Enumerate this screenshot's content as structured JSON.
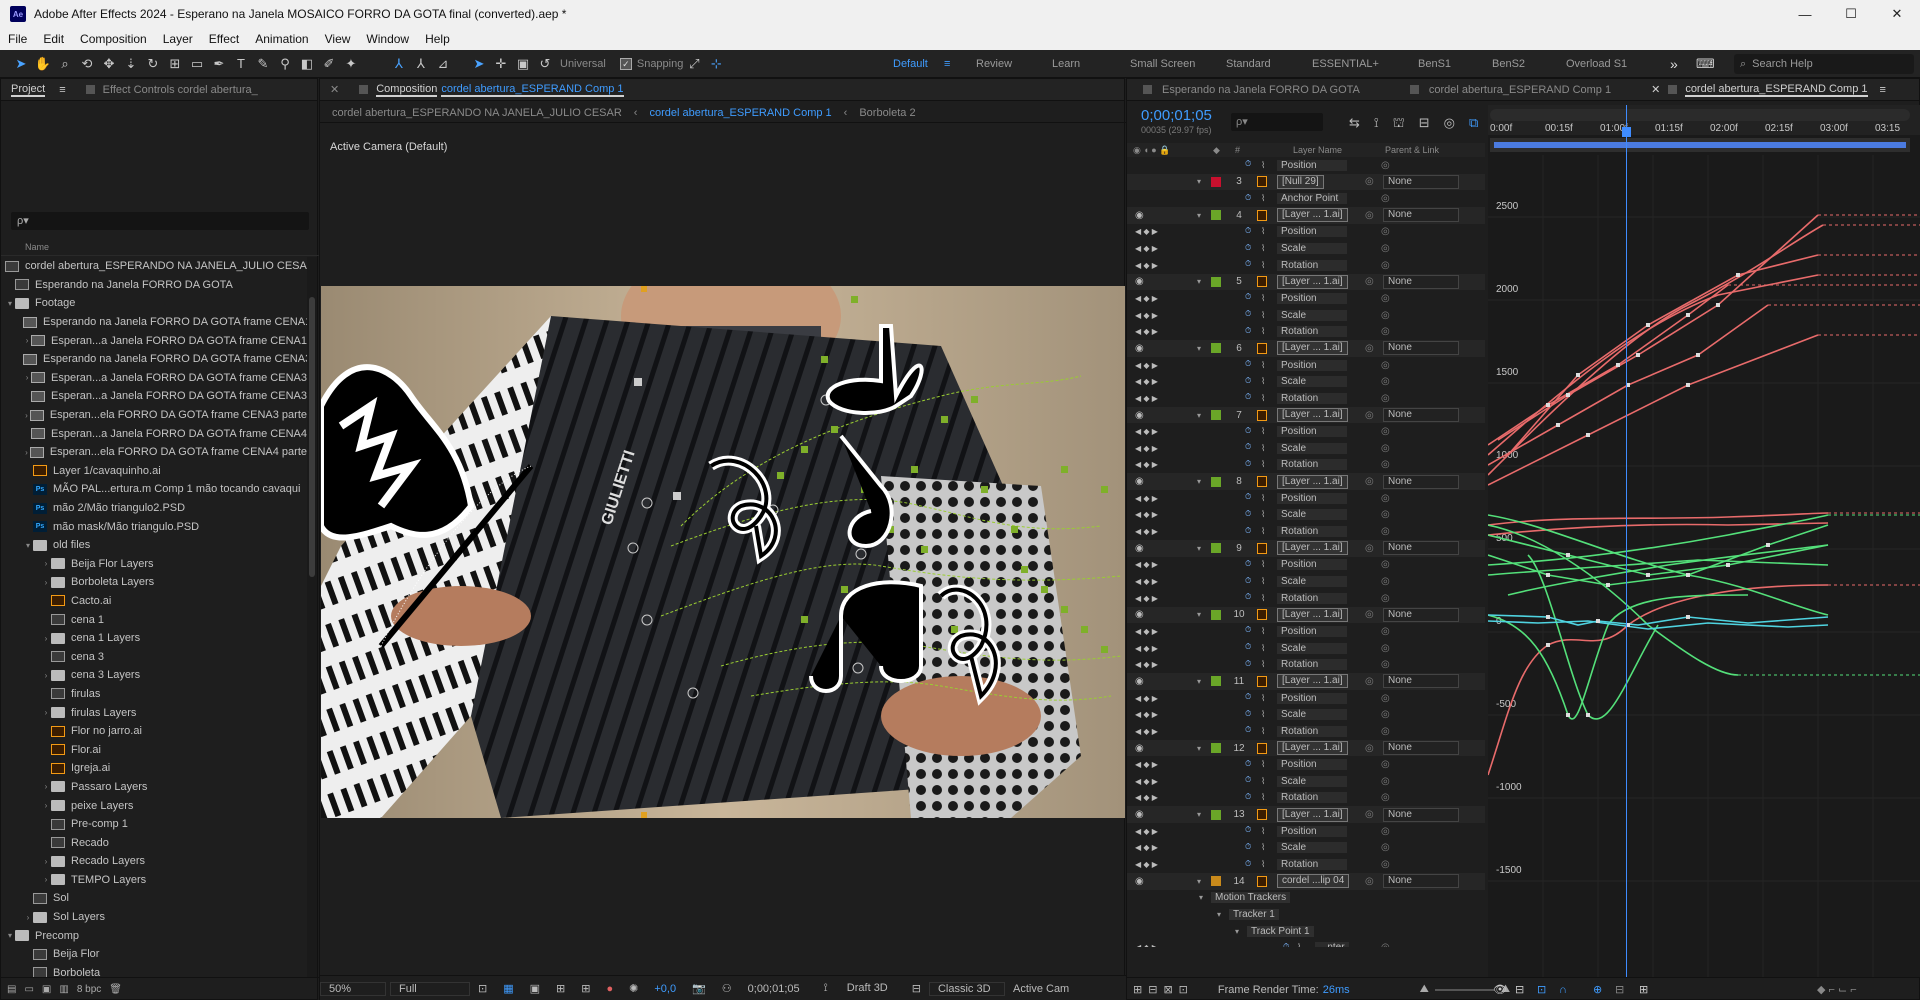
{
  "window": {
    "title": "Adobe After Effects 2024 - Esperano na Janela MOSAICO FORRO DA GOTA final (converted).aep *",
    "logo_text": "Ae",
    "minimize": "—",
    "maximize": "☐",
    "close": "✕"
  },
  "menu": [
    "File",
    "Edit",
    "Composition",
    "Layer",
    "Effect",
    "Animation",
    "View",
    "Window",
    "Help"
  ],
  "toolbar": {
    "universal_label": "Universal",
    "snapping_label": "Snapping",
    "workspaces": [
      "Default",
      "Review",
      "Learn",
      "Small Screen",
      "Standard",
      "ESSENTIAL+",
      "BenS1",
      "BenS2",
      "Overload S1"
    ],
    "active_workspace": "Default",
    "more": "»",
    "search_help": "Search Help"
  },
  "project_panel": {
    "tab_project": "Project",
    "tab_effect_controls": "Effect Controls cordel abertura_",
    "search_placeholder": "ρ▾",
    "column_name": "Name",
    "items": [
      {
        "indent": 0,
        "type": "comp",
        "twirl": "",
        "name": "cordel abertura_ESPERANDO NA JANELA_JULIO CESAR"
      },
      {
        "indent": 0,
        "type": "comp",
        "twirl": "",
        "name": "Esperando na Janela FORRO DA GOTA"
      },
      {
        "indent": 0,
        "type": "folder",
        "twirl": "▾",
        "name": "Footage"
      },
      {
        "indent": 1,
        "type": "film",
        "twirl": "",
        "name": "Esperando na Janela FORRO DA GOTA frame CENA1"
      },
      {
        "indent": 1,
        "type": "film",
        "twirl": "›",
        "name": "Esperan...a Janela FORRO DA GOTA frame CENA1"
      },
      {
        "indent": 1,
        "type": "film",
        "twirl": "",
        "name": "Esperando na Janela FORRO DA GOTA frame CENA3"
      },
      {
        "indent": 1,
        "type": "film",
        "twirl": "›",
        "name": "Esperan...a Janela FORRO DA GOTA frame CENA3"
      },
      {
        "indent": 1,
        "type": "film",
        "twirl": "",
        "name": "Esperan...a Janela FORRO DA GOTA frame CENA3"
      },
      {
        "indent": 1,
        "type": "film",
        "twirl": "›",
        "name": "Esperan...ela FORRO DA GOTA frame CENA3 parte"
      },
      {
        "indent": 1,
        "type": "film",
        "twirl": "",
        "name": "Esperan...a Janela FORRO DA GOTA frame CENA4"
      },
      {
        "indent": 1,
        "type": "film",
        "twirl": "›",
        "name": "Esperan...ela FORRO DA GOTA frame CENA4 parte"
      },
      {
        "indent": 1,
        "type": "ai",
        "twirl": "",
        "name": "Layer 1/cavaquinho.ai"
      },
      {
        "indent": 1,
        "type": "ps",
        "twirl": "",
        "name": "MÃO PAL...ertura.m Comp 1 mão tocando cavaqui"
      },
      {
        "indent": 1,
        "type": "ps",
        "twirl": "",
        "name": "mão 2/Mão triangulo2.PSD"
      },
      {
        "indent": 1,
        "type": "ps",
        "twirl": "",
        "name": "mão mask/Mão triangulo.PSD"
      },
      {
        "indent": 1,
        "type": "folder",
        "twirl": "▾",
        "name": "old files"
      },
      {
        "indent": 2,
        "type": "folder",
        "twirl": "›",
        "name": "Beija Flor Layers"
      },
      {
        "indent": 2,
        "type": "folder",
        "twirl": "›",
        "name": "Borboleta Layers"
      },
      {
        "indent": 2,
        "type": "ai",
        "twirl": "",
        "name": "Cacto.ai"
      },
      {
        "indent": 2,
        "type": "comp",
        "twirl": "",
        "name": "cena 1"
      },
      {
        "indent": 2,
        "type": "folder",
        "twirl": "›",
        "name": "cena 1 Layers"
      },
      {
        "indent": 2,
        "type": "comp",
        "twirl": "",
        "name": "cena 3"
      },
      {
        "indent": 2,
        "type": "folder",
        "twirl": "›",
        "name": "cena 3 Layers"
      },
      {
        "indent": 2,
        "type": "comp",
        "twirl": "",
        "name": "firulas"
      },
      {
        "indent": 2,
        "type": "folder",
        "twirl": "›",
        "name": "firulas Layers"
      },
      {
        "indent": 2,
        "type": "ai",
        "twirl": "",
        "name": "Flor no jarro.ai"
      },
      {
        "indent": 2,
        "type": "ai",
        "twirl": "",
        "name": "Flor.ai"
      },
      {
        "indent": 2,
        "type": "ai",
        "twirl": "",
        "name": "Igreja.ai"
      },
      {
        "indent": 2,
        "type": "folder",
        "twirl": "›",
        "name": "Passaro Layers"
      },
      {
        "indent": 2,
        "type": "folder",
        "twirl": "›",
        "name": "peixe Layers"
      },
      {
        "indent": 2,
        "type": "comp",
        "twirl": "",
        "name": "Pre-comp 1"
      },
      {
        "indent": 2,
        "type": "comp",
        "twirl": "",
        "name": "Recado"
      },
      {
        "indent": 2,
        "type": "folder",
        "twirl": "›",
        "name": "Recado Layers"
      },
      {
        "indent": 2,
        "type": "folder",
        "twirl": "›",
        "name": "TEMPO Layers"
      },
      {
        "indent": 1,
        "type": "comp",
        "twirl": "",
        "name": "Sol"
      },
      {
        "indent": 1,
        "type": "folder",
        "twirl": "›",
        "name": "Sol Layers"
      },
      {
        "indent": 0,
        "type": "folder",
        "twirl": "▾",
        "name": "Precomp"
      },
      {
        "indent": 1,
        "type": "comp",
        "twirl": "",
        "name": "Beija Flor"
      },
      {
        "indent": 1,
        "type": "comp",
        "twirl": "",
        "name": "Borboleta"
      }
    ],
    "bpc": "8 bpc"
  },
  "viewer": {
    "tab_prefix": "Composition",
    "tab_comp": "cordel abertura_ESPERAND Comp 1",
    "crumbs": [
      "cordel abertura_ESPERANDO NA JANELA_JULIO CESAR",
      "cordel abertura_ESPERAND Comp 1",
      "Borboleta 2"
    ],
    "active_camera": "Active Camera (Default)",
    "footer": {
      "zoom": "50%",
      "resolution": "Full",
      "exposure": "+0,0",
      "timecode": "0;00;01;05",
      "draft": "Draft 3D",
      "renderer": "Classic 3D",
      "camera": "Active Cam"
    }
  },
  "timeline": {
    "tabs": [
      "Esperando na Janela FORRO DA GOTA",
      "cordel abertura_ESPERAND Comp 1",
      "cordel abertura_ESPERAND Comp 1"
    ],
    "timecode": "0;00;01;05",
    "fps": "00035 (29.97 fps)",
    "search_placeholder": "ρ▾",
    "col_layer_name": "Layer Name",
    "col_parent": "Parent & Link",
    "col_hash": "#",
    "rows": [
      {
        "kind": "prop",
        "text": "Position",
        "eye": "",
        "kf": false
      },
      {
        "kind": "layer",
        "num": "3",
        "name": "[Null 29]",
        "parent": "None",
        "label_color": "#c8102e",
        "eye": ""
      },
      {
        "kind": "prop",
        "text": "Anchor Point",
        "eye": "",
        "kf": false
      },
      {
        "kind": "layer",
        "num": "4",
        "name": "[Layer ... 1.ai]",
        "parent": "None",
        "label_color": "#6aa628",
        "eye": "◉"
      },
      {
        "kind": "prop",
        "text": "Position",
        "kf": true
      },
      {
        "kind": "prop",
        "text": "Scale",
        "kf": true
      },
      {
        "kind": "prop",
        "text": "Rotation",
        "kf": true
      },
      {
        "kind": "layer",
        "num": "5",
        "name": "[Layer ... 1.ai]",
        "parent": "None",
        "label_color": "#6aa628",
        "eye": "◉"
      },
      {
        "kind": "prop",
        "text": "Position",
        "kf": true
      },
      {
        "kind": "prop",
        "text": "Scale",
        "kf": true
      },
      {
        "kind": "prop",
        "text": "Rotation",
        "kf": true
      },
      {
        "kind": "layer",
        "num": "6",
        "name": "[Layer ... 1.ai]",
        "parent": "None",
        "label_color": "#6aa628",
        "eye": "◉"
      },
      {
        "kind": "prop",
        "text": "Position",
        "kf": true
      },
      {
        "kind": "prop",
        "text": "Scale",
        "kf": true
      },
      {
        "kind": "prop",
        "text": "Rotation",
        "kf": true
      },
      {
        "kind": "layer",
        "num": "7",
        "name": "[Layer ... 1.ai]",
        "parent": "None",
        "label_color": "#6aa628",
        "eye": "◉"
      },
      {
        "kind": "prop",
        "text": "Position",
        "kf": true
      },
      {
        "kind": "prop",
        "text": "Scale",
        "kf": true
      },
      {
        "kind": "prop",
        "text": "Rotation",
        "kf": true
      },
      {
        "kind": "layer",
        "num": "8",
        "name": "[Layer ... 1.ai]",
        "parent": "None",
        "label_color": "#6aa628",
        "eye": "◉"
      },
      {
        "kind": "prop",
        "text": "Position",
        "kf": true
      },
      {
        "kind": "prop",
        "text": "Scale",
        "kf": true
      },
      {
        "kind": "prop",
        "text": "Rotation",
        "kf": true
      },
      {
        "kind": "layer",
        "num": "9",
        "name": "[Layer ... 1.ai]",
        "parent": "None",
        "label_color": "#6aa628",
        "eye": "◉"
      },
      {
        "kind": "prop",
        "text": "Position",
        "kf": true
      },
      {
        "kind": "prop",
        "text": "Scale",
        "kf": true
      },
      {
        "kind": "prop",
        "text": "Rotation",
        "kf": true
      },
      {
        "kind": "layer",
        "num": "10",
        "name": "[Layer ... 1.ai]",
        "parent": "None",
        "label_color": "#6aa628",
        "eye": "◉"
      },
      {
        "kind": "prop",
        "text": "Position",
        "kf": true
      },
      {
        "kind": "prop",
        "text": "Scale",
        "kf": true
      },
      {
        "kind": "prop",
        "text": "Rotation",
        "kf": true
      },
      {
        "kind": "layer",
        "num": "11",
        "name": "[Layer ... 1.ai]",
        "parent": "None",
        "label_color": "#6aa628",
        "eye": "◉"
      },
      {
        "kind": "prop",
        "text": "Position",
        "kf": true
      },
      {
        "kind": "prop",
        "text": "Scale",
        "kf": true
      },
      {
        "kind": "prop",
        "text": "Rotation",
        "kf": true
      },
      {
        "kind": "layer",
        "num": "12",
        "name": "[Layer ... 1.ai]",
        "parent": "None",
        "label_color": "#6aa628",
        "eye": "◉"
      },
      {
        "kind": "prop",
        "text": "Position",
        "kf": true
      },
      {
        "kind": "prop",
        "text": "Scale",
        "kf": true
      },
      {
        "kind": "prop",
        "text": "Rotation",
        "kf": true
      },
      {
        "kind": "layer",
        "num": "13",
        "name": "[Layer ... 1.ai]",
        "parent": "None",
        "label_color": "#6aa628",
        "eye": "◉"
      },
      {
        "kind": "prop",
        "text": "Position",
        "kf": true
      },
      {
        "kind": "prop",
        "text": "Scale",
        "kf": true
      },
      {
        "kind": "prop",
        "text": "Rotation",
        "kf": true
      },
      {
        "kind": "layer",
        "num": "14",
        "name": "cordel ...lip 04",
        "parent": "None",
        "label_color": "#c98a1b",
        "eye": "◉"
      },
      {
        "kind": "group",
        "text": "Motion Trackers",
        "depth": 0
      },
      {
        "kind": "group",
        "text": "Tracker 1",
        "depth": 1
      },
      {
        "kind": "group",
        "text": "Track Point 1",
        "depth": 2
      },
      {
        "kind": "prop",
        "text": "...nter",
        "kf": true,
        "deep": true
      },
      {
        "kind": "prop",
        "text": "...ence",
        "kf": true,
        "deep": true
      },
      {
        "kind": "prop",
        "text": "...oint",
        "kf": true,
        "deep": true
      }
    ],
    "ruler": [
      "0:00f",
      "00:15f",
      "01:00f",
      "01:15f",
      "02:00f",
      "02:15f",
      "03:00f",
      "03:15"
    ],
    "y_labels": [
      "2500",
      "2000",
      "1500",
      "1000",
      "500",
      "0",
      "-500",
      "-1000",
      "-1500"
    ],
    "frame_render_label": "Frame Render Time:",
    "frame_render_value": "26ms"
  },
  "colors": {
    "accent": "#3f9cff",
    "curve_red": "#e86b6b",
    "curve_green": "#54e07a",
    "curve_cyan": "#4fd3e0",
    "motion_path": "#9acd32"
  }
}
